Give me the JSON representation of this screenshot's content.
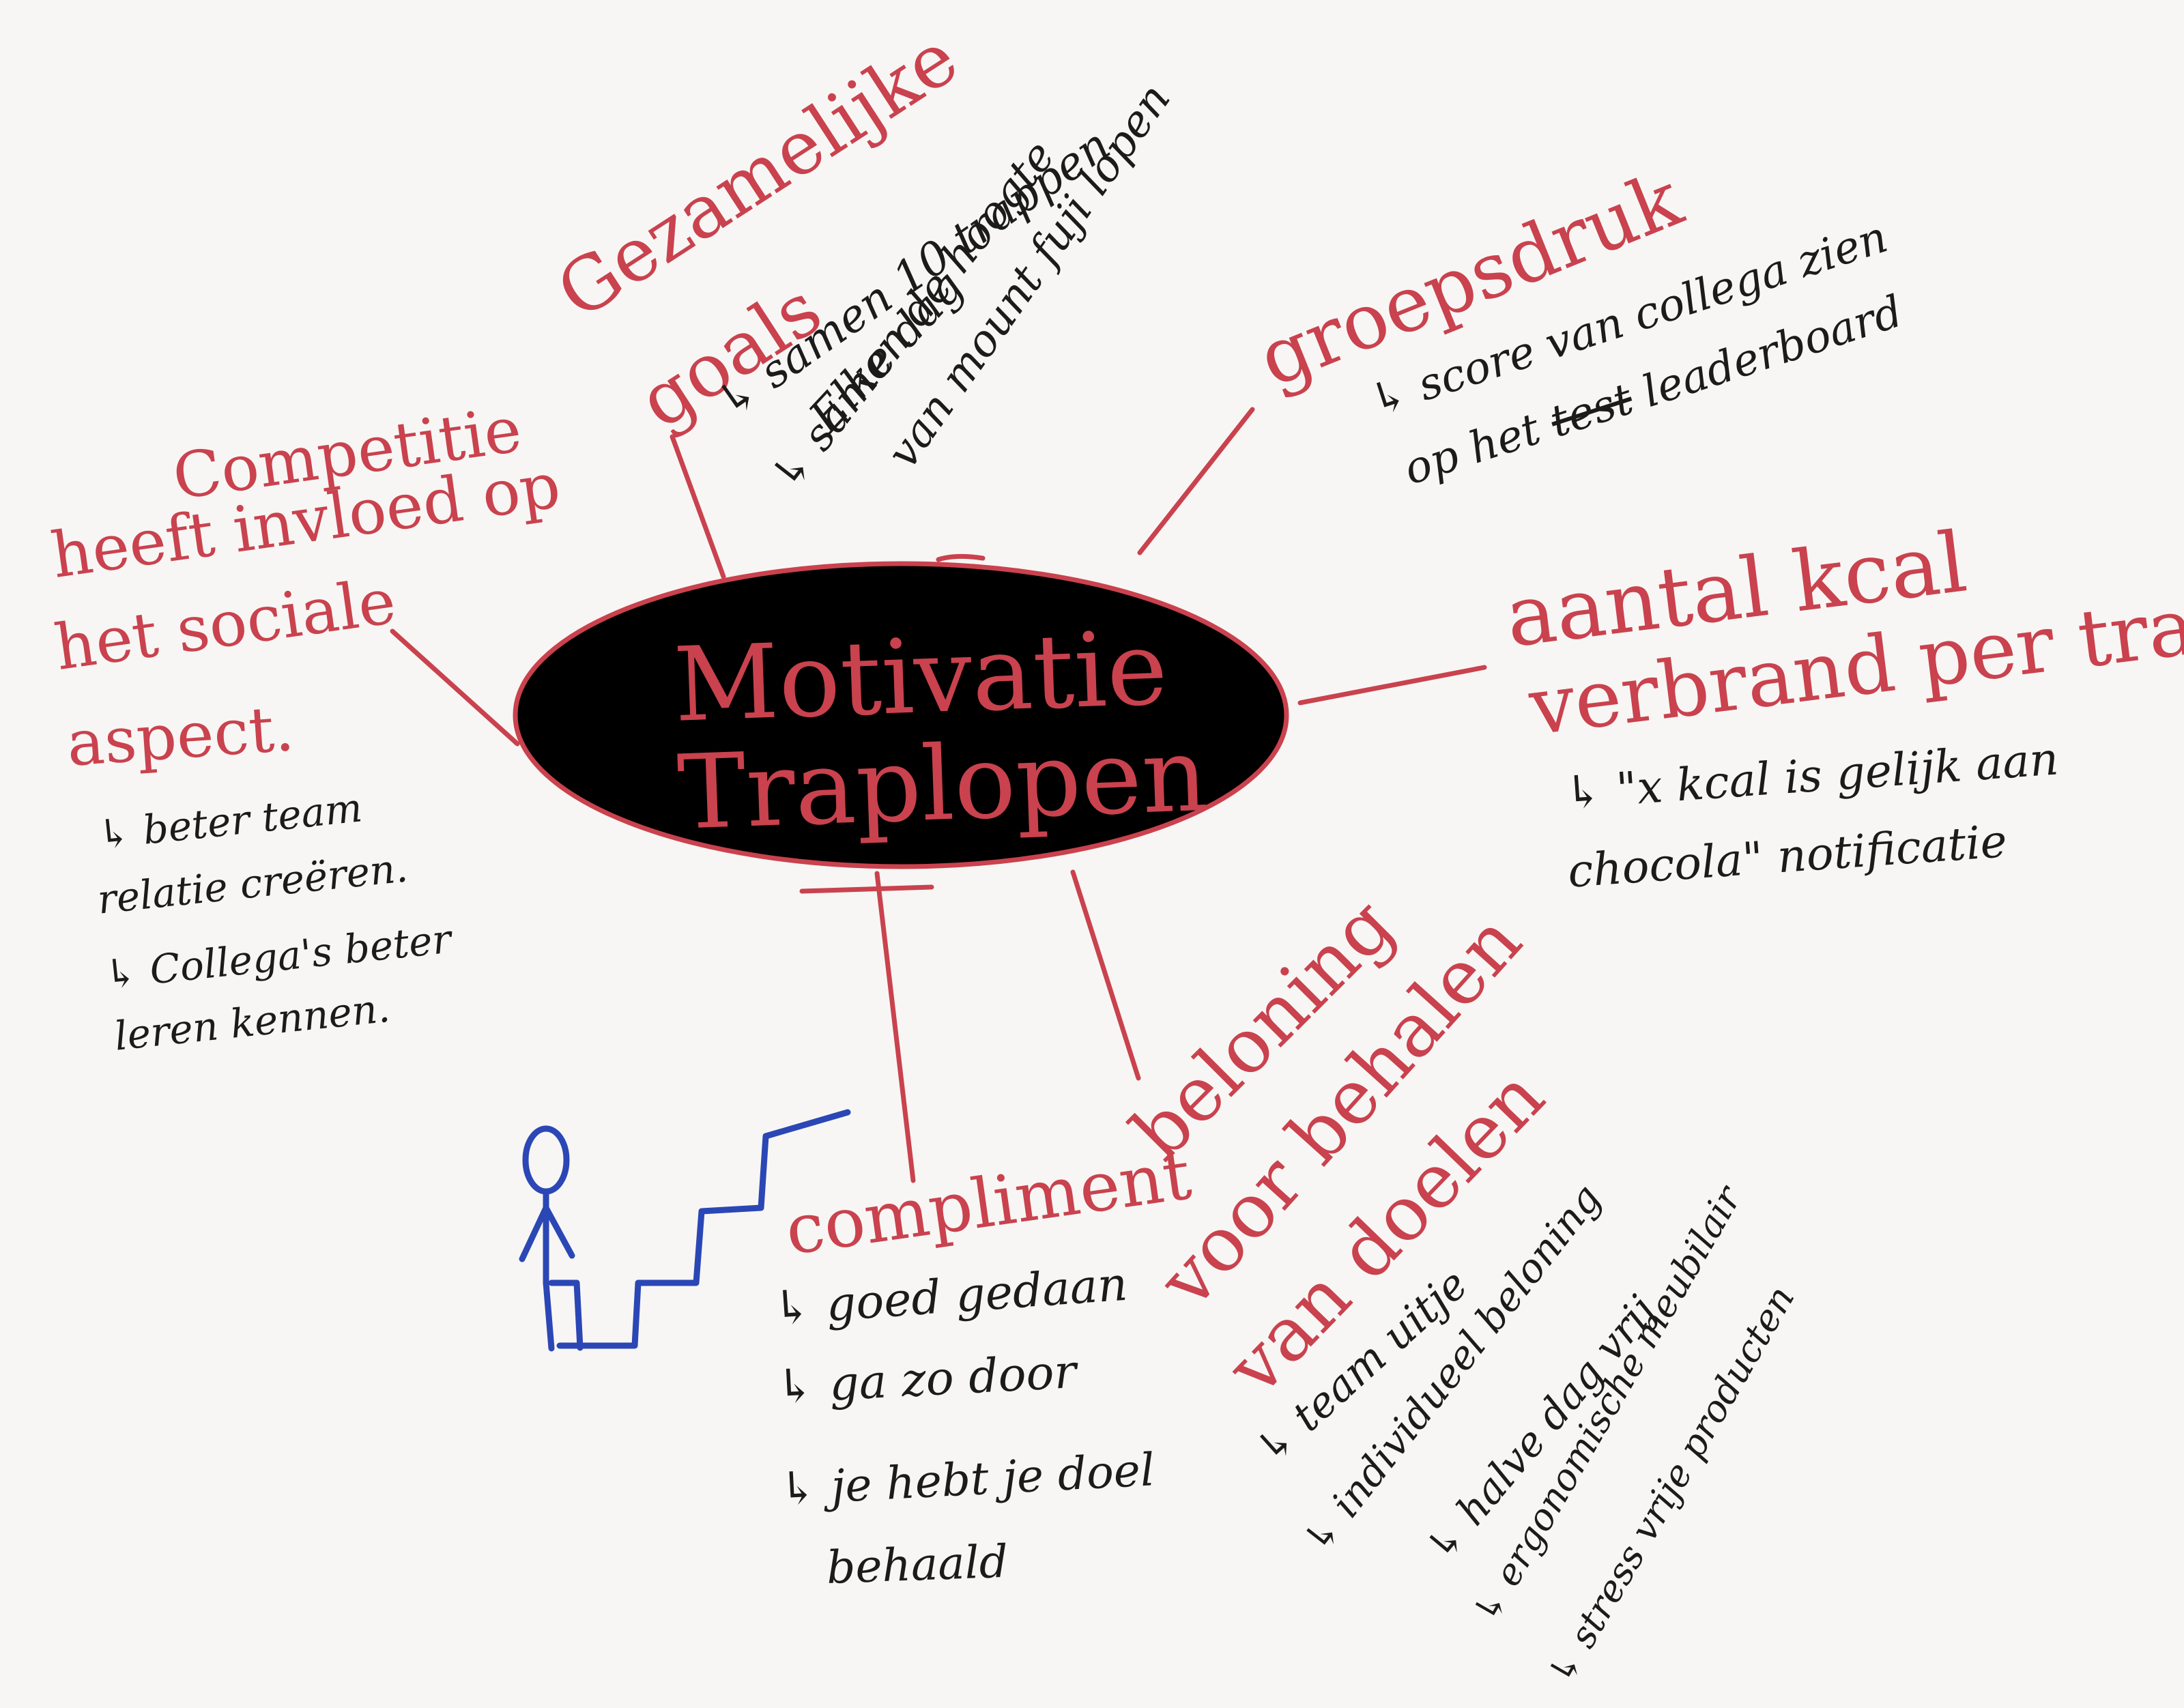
{
  "center": {
    "line1": "Motivatie",
    "line2": "Traplopen"
  },
  "branches": {
    "gezamenlijke_goals": {
      "title_line1": "Gezamelijke",
      "title_line2": "goals",
      "items": [
        "samen 10 trappen",
        "Elke dag",
        "samen de hoogte",
        "van mount fuji lopen"
      ]
    },
    "groepsdruk": {
      "title": "groepsdruk",
      "note_line1": "score van collega zien",
      "note_line2_a": "op het",
      "note_crossed": "test",
      "note_line2_b": "leaderboard"
    },
    "kcal": {
      "title_line1": "aantal kcal",
      "title_line2": "verbrand per trap",
      "note_line1": "\"x kcal is gelijk aan",
      "note_line2": "chocola\" notificatie"
    },
    "competitie": {
      "title_lines": [
        "Competitie",
        "heeft invloed op",
        "het sociale",
        "aspect."
      ],
      "items": [
        {
          "line1": "beter team",
          "line2": "relatie creëren."
        },
        {
          "line1": "Collega's beter",
          "line2": "leren kennen."
        }
      ]
    },
    "compliment": {
      "title": "compliment",
      "items": [
        "goed gedaan",
        "ga zo door"
      ],
      "last_line1": "je hebt je doel",
      "last_line2": "behaald"
    },
    "beloning": {
      "title_lines": [
        "beloning",
        "voor behalen",
        "van doelen"
      ],
      "items": [
        "team uitje",
        "individueel beloning",
        "halve dag vrij",
        "ergonomische meubilair",
        "stress vrije producten"
      ]
    }
  },
  "colors": {
    "red_ink": "#c9424e",
    "black_ink": "#1b1b1b",
    "blue_ink": "#2b47b5",
    "paper": "#f7f6f4"
  },
  "icons": [
    "stick-figure-icon",
    "staircase-icon",
    "arrow-hook-icon"
  ]
}
